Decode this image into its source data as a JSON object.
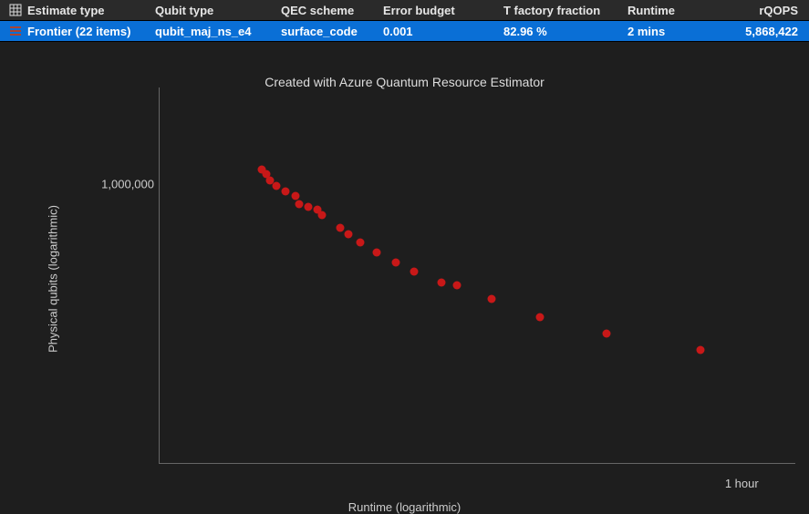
{
  "table": {
    "headers": {
      "estimate_type": "Estimate type",
      "qubit_type": "Qubit type",
      "qec_scheme": "QEC scheme",
      "error_budget": "Error budget",
      "t_factory_fraction": "T factory fraction",
      "runtime": "Runtime",
      "rqops": "rQOPS"
    },
    "row": {
      "estimate_type": "Frontier (22 items)",
      "qubit_type": "qubit_maj_ns_e4",
      "qec_scheme": "surface_code",
      "error_budget": "0.001",
      "t_factory_fraction": "82.96 %",
      "runtime": "2 mins",
      "rqops": "5,868,422"
    },
    "header_icon": "grid-icon",
    "row_icon": "list-icon"
  },
  "chart": {
    "title": "Created with Azure Quantum Resource Estimator",
    "ylabel": "Physical qubits (logarithmic)",
    "xlabel": "Runtime (logarithmic)",
    "y_ticks": [
      {
        "label": "1,000,000",
        "frac": 0.76
      }
    ],
    "x_ticks": [
      {
        "label": "1 hour",
        "frac": 0.925
      }
    ]
  },
  "chart_data": {
    "type": "scatter",
    "title": "Created with Azure Quantum Resource Estimator",
    "xlabel": "Runtime (logarithmic)",
    "ylabel": "Physical qubits (logarithmic)",
    "x_scale": "log",
    "y_scale": "log",
    "y_ticks_labeled": [
      1000000
    ],
    "x_ticks_labeled": [
      "1 hour"
    ],
    "series": [
      {
        "name": "Frontier",
        "color": "#c81818",
        "points": [
          {
            "runtime_seconds": 120,
            "physical_qubits": 960000,
            "px": 0.163,
            "py": 0.8
          },
          {
            "runtime_seconds": 125,
            "physical_qubits": 920000,
            "px": 0.17,
            "py": 0.788
          },
          {
            "runtime_seconds": 133,
            "physical_qubits": 870000,
            "px": 0.175,
            "py": 0.77
          },
          {
            "runtime_seconds": 140,
            "physical_qubits": 830000,
            "px": 0.186,
            "py": 0.755
          },
          {
            "runtime_seconds": 150,
            "physical_qubits": 800000,
            "px": 0.2,
            "py": 0.74
          },
          {
            "runtime_seconds": 163,
            "physical_qubits": 770000,
            "px": 0.216,
            "py": 0.727
          },
          {
            "runtime_seconds": 178,
            "physical_qubits": 740000,
            "px": 0.222,
            "py": 0.706
          },
          {
            "runtime_seconds": 185,
            "physical_qubits": 720000,
            "px": 0.236,
            "py": 0.698
          },
          {
            "runtime_seconds": 200,
            "physical_qubits": 710000,
            "px": 0.251,
            "py": 0.69
          },
          {
            "runtime_seconds": 215,
            "physical_qubits": 680000,
            "px": 0.258,
            "py": 0.675
          },
          {
            "runtime_seconds": 238,
            "physical_qubits": 620000,
            "px": 0.287,
            "py": 0.64
          },
          {
            "runtime_seconds": 260,
            "physical_qubits": 590000,
            "px": 0.3,
            "py": 0.622
          },
          {
            "runtime_seconds": 290,
            "physical_qubits": 560000,
            "px": 0.319,
            "py": 0.6
          },
          {
            "runtime_seconds": 320,
            "physical_qubits": 520000,
            "px": 0.345,
            "py": 0.572
          },
          {
            "runtime_seconds": 360,
            "physical_qubits": 480000,
            "px": 0.375,
            "py": 0.545
          },
          {
            "runtime_seconds": 410,
            "physical_qubits": 450000,
            "px": 0.405,
            "py": 0.52
          },
          {
            "runtime_seconds": 480,
            "physical_qubits": 400000,
            "px": 0.448,
            "py": 0.49
          },
          {
            "runtime_seconds": 550,
            "physical_qubits": 390000,
            "px": 0.473,
            "py": 0.483
          },
          {
            "runtime_seconds": 700,
            "physical_qubits": 350000,
            "px": 0.528,
            "py": 0.445
          },
          {
            "runtime_seconds": 1000,
            "physical_qubits": 300000,
            "px": 0.605,
            "py": 0.395
          },
          {
            "runtime_seconds": 1700,
            "physical_qubits": 260000,
            "px": 0.71,
            "py": 0.35
          },
          {
            "runtime_seconds": 3200,
            "physical_qubits": 230000,
            "px": 0.86,
            "py": 0.305
          }
        ]
      }
    ]
  }
}
